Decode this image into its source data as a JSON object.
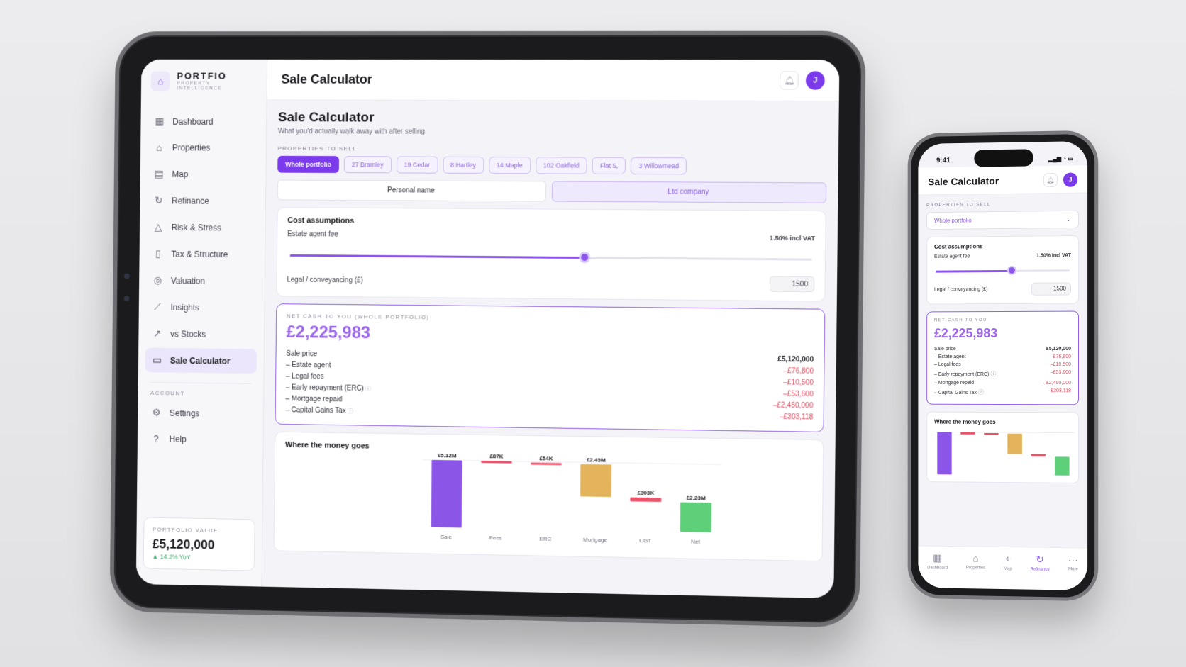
{
  "brand": {
    "name": "PORTFIO",
    "tagline": "PROPERTY INTELLIGENCE"
  },
  "sidebar": {
    "items": [
      {
        "label": "Dashboard",
        "icon": "grid-icon"
      },
      {
        "label": "Properties",
        "icon": "home-icon"
      },
      {
        "label": "Map",
        "icon": "map-icon"
      },
      {
        "label": "Refinance",
        "icon": "refresh-icon"
      },
      {
        "label": "Risk & Stress",
        "icon": "warning-icon"
      },
      {
        "label": "Tax & Structure",
        "icon": "document-icon"
      },
      {
        "label": "Valuation",
        "icon": "check-circle-icon"
      },
      {
        "label": "Insights",
        "icon": "line-chart-icon"
      },
      {
        "label": "vs Stocks",
        "icon": "trend-up-icon"
      },
      {
        "label": "Sale Calculator",
        "icon": "calculator-icon",
        "active": true
      }
    ],
    "account_label": "ACCOUNT",
    "account_items": [
      {
        "label": "Settings",
        "icon": "gear-icon"
      },
      {
        "label": "Help",
        "icon": "help-icon"
      }
    ],
    "portfolio": {
      "label": "PORTFOLIO VALUE",
      "value": "£5,120,000",
      "change": "▲ 14.2% YoY"
    }
  },
  "topbar": {
    "title": "Sale Calculator",
    "avatar": "J"
  },
  "page": {
    "title": "Sale Calculator",
    "subtitle": "What you'd actually walk away with after selling",
    "properties_label": "PROPERTIES TO SELL",
    "chips": [
      "Whole portfolio",
      "27 Bramley",
      "19 Cedar",
      "8 Hartley",
      "14 Maple",
      "102 Oakfield",
      "Flat 5,",
      "3 Willowmead"
    ],
    "ownership": {
      "personal": "Personal name",
      "ltd": "Ltd company"
    },
    "costs": {
      "title": "Cost assumptions",
      "agent_fee_label": "Estate agent fee",
      "agent_fee_value": "1.50% incl VAT",
      "agent_fee_fraction": 0.57,
      "legal_label": "Legal / conveyancing (£)",
      "legal_value": "1500"
    },
    "net": {
      "label": "NET CASH TO YOU (WHOLE PORTFOLIO)",
      "value": "£2,225,983",
      "lines": [
        {
          "label": "Sale price",
          "value": "£5,120,000",
          "kind": "pos"
        },
        {
          "label": "– Estate agent",
          "value": "–£76,800",
          "kind": "neg"
        },
        {
          "label": "– Legal fees",
          "value": "–£10,500",
          "kind": "neg"
        },
        {
          "label": "– Early repayment (ERC)",
          "value": "–£53,600",
          "kind": "neg",
          "info": true
        },
        {
          "label": "– Mortgage repaid",
          "value": "–£2,450,000",
          "kind": "neg"
        },
        {
          "label": "– Capital Gains Tax",
          "value": "–£303,118",
          "kind": "neg",
          "info": true
        }
      ]
    }
  },
  "chart_data": {
    "type": "bar",
    "title": "Where the money goes",
    "categories": [
      "Sale",
      "Fees",
      "ERC",
      "Mortgage",
      "CGT",
      "Net"
    ],
    "values": [
      5120000,
      -87300,
      -53600,
      -2450000,
      -303118,
      2225983
    ],
    "labels": [
      "£5.12M",
      "£87K",
      "£54K",
      "£2.45M",
      "£303K",
      "£2.23M"
    ],
    "colors": [
      "#8b55e8",
      "#e8546a",
      "#e8546a",
      "#e3b45c",
      "#e8546a",
      "#5fd07a"
    ]
  },
  "phone": {
    "time": "9:41",
    "title": "Sale Calculator",
    "avatar": "J",
    "properties_label": "PROPERTIES TO SELL",
    "selected": "Whole portfolio",
    "net_label": "NET CASH TO YOU",
    "chart_title": "Where the money goes",
    "tabs": [
      {
        "label": "Dashboard",
        "icon": "grid-icon"
      },
      {
        "label": "Properties",
        "icon": "home-icon"
      },
      {
        "label": "Map",
        "icon": "pin-icon"
      },
      {
        "label": "Refinance",
        "icon": "refresh-icon",
        "active": true
      },
      {
        "label": "More",
        "icon": "more-icon"
      }
    ]
  }
}
